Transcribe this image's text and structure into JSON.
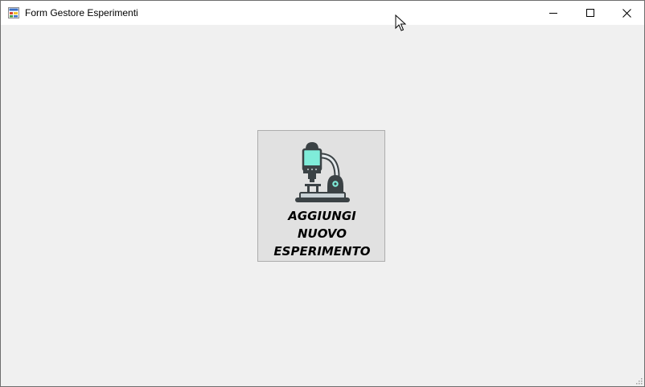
{
  "window": {
    "title": "Form Gestore Esperimenti",
    "icon": "winforms-app-icon",
    "controls": [
      "minimize-icon",
      "maximize-icon",
      "close-icon"
    ]
  },
  "main": {
    "add_button": {
      "icon": "microscope-icon",
      "label_lines": [
        "AGGIUNGI",
        "NUOVO",
        "ESPERIMENTO"
      ]
    }
  },
  "colors": {
    "title_bar": "#ffffff",
    "client_background": "#f0f0f0",
    "button_face": "#e1e1e1",
    "button_border": "#adadad",
    "microscope_lens": "#7fecd9",
    "microscope_body": "#3b4245"
  }
}
